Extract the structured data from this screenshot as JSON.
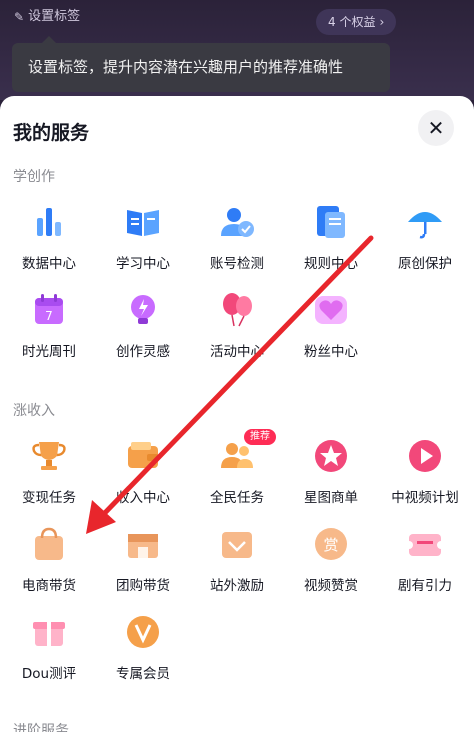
{
  "header": {
    "tag_label": "设置标签",
    "rights_label": "4 个权益",
    "tooltip": "设置标签，提升内容潜在兴趣用户的推荐准确性"
  },
  "sheet": {
    "title": "我的服务",
    "close_label": "✕"
  },
  "sections": [
    {
      "title": "学创作",
      "items": [
        {
          "label": "数据中心",
          "icon": "bar-chart-icon"
        },
        {
          "label": "学习中心",
          "icon": "book-icon"
        },
        {
          "label": "账号检测",
          "icon": "account-check-icon"
        },
        {
          "label": "规则中心",
          "icon": "document-icon"
        },
        {
          "label": "原创保护",
          "icon": "umbrella-icon"
        },
        {
          "label": "时光周刊",
          "icon": "calendar-icon"
        },
        {
          "label": "创作灵感",
          "icon": "lightbulb-icon"
        },
        {
          "label": "活动中心",
          "icon": "balloon-icon"
        },
        {
          "label": "粉丝中心",
          "icon": "heart-icon"
        }
      ]
    },
    {
      "title": "涨收入",
      "items": [
        {
          "label": "变现任务",
          "icon": "trophy-icon"
        },
        {
          "label": "收入中心",
          "icon": "wallet-icon"
        },
        {
          "label": "全民任务",
          "icon": "users-icon",
          "badge": "推荐"
        },
        {
          "label": "星图商单",
          "icon": "star-map-icon"
        },
        {
          "label": "中视频计划",
          "icon": "play-icon"
        },
        {
          "label": "电商带货",
          "icon": "shopping-bag-icon"
        },
        {
          "label": "团购带货",
          "icon": "store-icon"
        },
        {
          "label": "站外激励",
          "icon": "gift-card-icon"
        },
        {
          "label": "视频赞赏",
          "icon": "appreciate-icon"
        },
        {
          "label": "剧有引力",
          "icon": "ticket-icon"
        },
        {
          "label": "Dou测评",
          "icon": "gift-box-icon"
        },
        {
          "label": "专属会员",
          "icon": "vip-icon"
        }
      ]
    }
  ],
  "next_section_title": "进阶服务",
  "colors": {
    "accent_red": "#e8262c",
    "badge_red": "#fe2c55",
    "blue": "#2f7cf6",
    "purple": "#b55cf2",
    "orange": "#f5a04a",
    "pink": "#f2487a"
  }
}
